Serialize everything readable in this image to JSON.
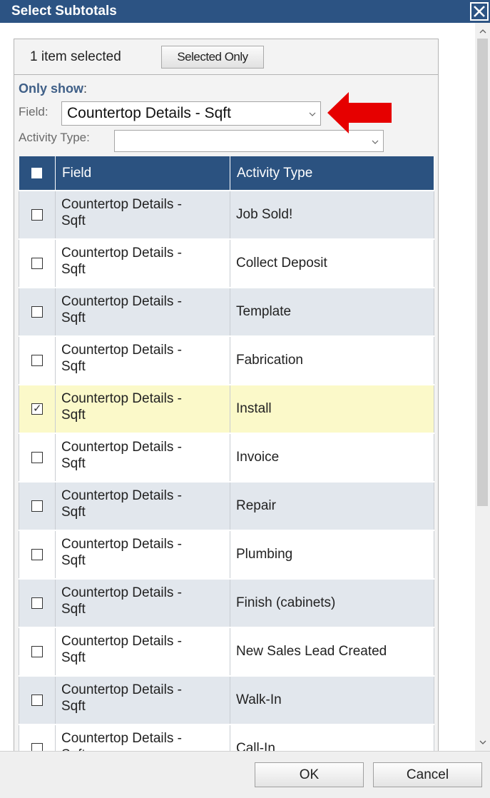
{
  "dialog": {
    "title": "Select Subtotals"
  },
  "selection": {
    "count_text": "1 item selected",
    "selected_only_label": "Selected Only"
  },
  "filters": {
    "only_show_label": "Only show",
    "field_label": "Field:",
    "field_value": "Countertop Details - Sqft",
    "activity_type_label": "Activity Type:",
    "activity_type_value": ""
  },
  "table": {
    "columns": [
      "Field",
      "Activity Type"
    ],
    "rows": [
      {
        "field_line1": "Countertop Details -",
        "field_line2": "Sqft",
        "activity": "Job Sold!",
        "checked": false
      },
      {
        "field_line1": "Countertop Details -",
        "field_line2": "Sqft",
        "activity": "Collect Deposit",
        "checked": false
      },
      {
        "field_line1": "Countertop Details -",
        "field_line2": "Sqft",
        "activity": "Template",
        "checked": false
      },
      {
        "field_line1": "Countertop Details -",
        "field_line2": "Sqft",
        "activity": "Fabrication",
        "checked": false
      },
      {
        "field_line1": "Countertop Details -",
        "field_line2": "Sqft",
        "activity": "Install",
        "checked": true
      },
      {
        "field_line1": "Countertop Details -",
        "field_line2": "Sqft",
        "activity": "Invoice",
        "checked": false
      },
      {
        "field_line1": "Countertop Details -",
        "field_line2": "Sqft",
        "activity": "Repair",
        "checked": false
      },
      {
        "field_line1": "Countertop Details -",
        "field_line2": "Sqft",
        "activity": "Plumbing",
        "checked": false
      },
      {
        "field_line1": "Countertop Details -",
        "field_line2": "Sqft",
        "activity": "Finish (cabinets)",
        "checked": false
      },
      {
        "field_line1": "Countertop Details -",
        "field_line2": "Sqft",
        "activity": "New Sales Lead Created",
        "checked": false
      },
      {
        "field_line1": "Countertop Details -",
        "field_line2": "Sqft",
        "activity": "Walk-In",
        "checked": false
      },
      {
        "field_line1": "Countertop Details -",
        "field_line2": "Sqft",
        "activity": "Call-In",
        "checked": false
      }
    ]
  },
  "footer": {
    "ok_label": "OK",
    "cancel_label": "Cancel"
  },
  "colors": {
    "title_bar": "#2c5383",
    "header_row": "#2b5280",
    "row_alt": "#e2e7ed",
    "row_selected": "#fbf9c9",
    "annotation_arrow": "#e60000"
  },
  "icons": {
    "close": "close-icon",
    "dropdown": "chevron-down-icon",
    "annotation": "red-arrow-icon"
  }
}
